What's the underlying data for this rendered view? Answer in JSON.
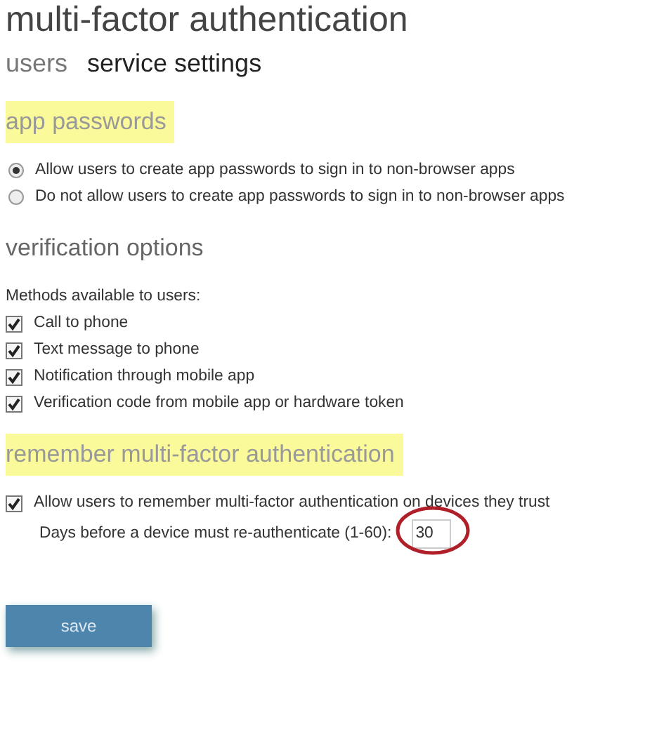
{
  "title": "multi-factor authentication",
  "tabs": [
    {
      "label": "users",
      "selected": false
    },
    {
      "label": "service settings",
      "selected": true
    }
  ],
  "sections": [
    {
      "heading": "app passwords",
      "highlighted": true,
      "items": [
        {
          "kind": "radio",
          "label": "Allow users to create app passwords to sign in to non-browser apps",
          "selected": true
        },
        {
          "kind": "radio",
          "label": "Do not allow users to create app passwords to sign in to non-browser apps",
          "selected": false
        }
      ]
    },
    {
      "heading": "verification options",
      "highlighted": false,
      "items": [
        {
          "kind": "text",
          "label": "Methods available to users:"
        },
        {
          "kind": "checkbox",
          "label": "Call to phone",
          "checked": true
        },
        {
          "kind": "checkbox",
          "label": "Text message to phone",
          "checked": true
        },
        {
          "kind": "checkbox",
          "label": "Notification through mobile app",
          "checked": true
        },
        {
          "kind": "checkbox",
          "label": "Verification code from mobile app or hardware token",
          "checked": true
        }
      ]
    },
    {
      "heading": "remember multi-factor authentication",
      "highlighted": true,
      "items": [
        {
          "kind": "checkbox",
          "label": "Allow users to remember multi-factor authentication on devices they trust",
          "checked": true
        },
        {
          "kind": "number",
          "label": "Days before a device must re-authenticate (1-60):",
          "value": "30",
          "circled": true
        }
      ]
    }
  ],
  "save_button": {
    "label": "save",
    "disabled": true
  }
}
